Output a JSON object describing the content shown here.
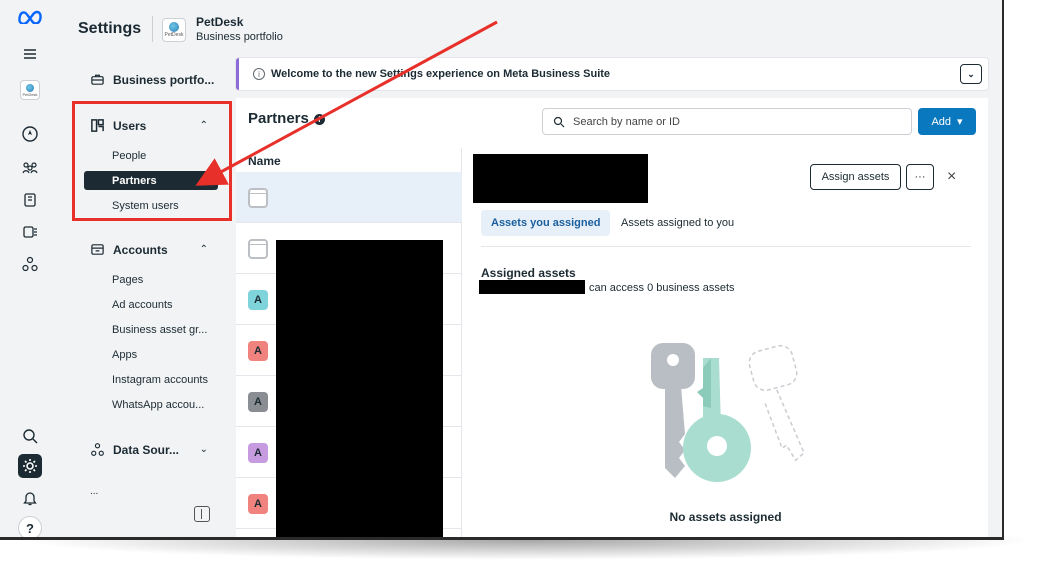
{
  "header": {
    "title": "Settings",
    "business_logo_text": "PetDesk",
    "business_name": "PetDesk",
    "business_subtitle": "Business portfolio"
  },
  "rail": {
    "avatar_text": "PetDesk",
    "help_label": "?"
  },
  "nav": {
    "business_portfolio": "Business portfo...",
    "users": {
      "label": "Users",
      "items": [
        "People",
        "Partners",
        "System users"
      ],
      "active": "Partners"
    },
    "accounts": {
      "label": "Accounts",
      "items": [
        "Pages",
        "Ad accounts",
        "Business asset gr...",
        "Apps",
        "Instagram accounts",
        "WhatsApp accou..."
      ]
    },
    "data_sources": {
      "label": "Data Sour..."
    },
    "partial_label": "..."
  },
  "banner": {
    "text": "Welcome to the new Settings experience on Meta Business Suite"
  },
  "partners": {
    "title": "Partners",
    "search_placeholder": "Search by name or ID",
    "add_label": "Add",
    "list_header": "Name",
    "rows": [
      {
        "avatar": "",
        "color": "blank"
      },
      {
        "avatar": "",
        "color": "blank"
      },
      {
        "avatar": "A",
        "color": "#7fd3da"
      },
      {
        "avatar": "A",
        "color": "#f0837e"
      },
      {
        "avatar": "A",
        "color": "#8a8d91"
      },
      {
        "avatar": "A",
        "color": "#c79be0"
      },
      {
        "avatar": "A",
        "color": "#f0837e"
      }
    ]
  },
  "detail": {
    "assign_label": "Assign assets",
    "more_label": "···",
    "close_label": "×",
    "tabs": [
      "Assets you assigned",
      "Assets assigned to you"
    ],
    "assigned_title": "Assigned assets",
    "access_text": "can access 0 business assets",
    "empty_title": "No assets assigned"
  },
  "colors": {
    "primary": "#0a78be",
    "annotation_red": "#e8302a",
    "nav_active": "#1c2b33"
  }
}
